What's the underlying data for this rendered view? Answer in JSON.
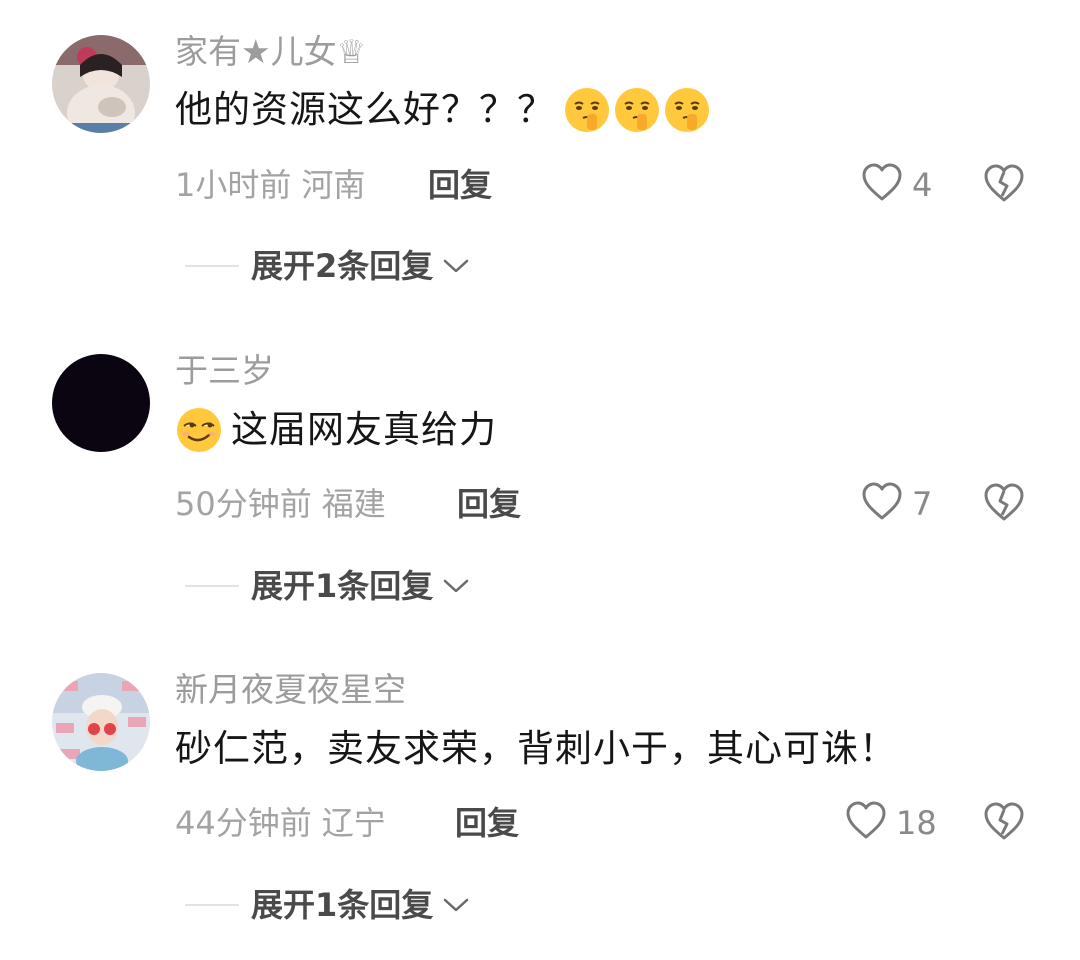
{
  "comments": [
    {
      "username": "家有★儿女♕",
      "text": "他的资源这么好？？？",
      "emoji": "thinking-hush-emoji",
      "time": "1小时前",
      "location": "河南",
      "reply_label": "回复",
      "likes": "4",
      "expand_label": "展开2条回复"
    },
    {
      "username": "于三岁",
      "text": "这届网友真给力",
      "emoji": "smirk-emoji",
      "time": "50分钟前",
      "location": "福建",
      "reply_label": "回复",
      "likes": "7",
      "expand_label": "展开1条回复"
    },
    {
      "username": "新月夜夏夜星空",
      "text": "砂仁范，卖友求荣，背刺小于，其心可诛！",
      "time": "44分钟前",
      "location": "辽宁",
      "reply_label": "回复",
      "likes": "18",
      "expand_label": "展开1条回复"
    }
  ],
  "icons": {
    "like": "heart-outline-icon",
    "dislike": "broken-heart-icon",
    "expand": "chevron-down-icon"
  },
  "colors": {
    "username": "#9c9c9c",
    "text": "#161616",
    "meta": "#a3a3a3",
    "action": "#4a4a4a",
    "emoji_face": "#ffc83d"
  }
}
